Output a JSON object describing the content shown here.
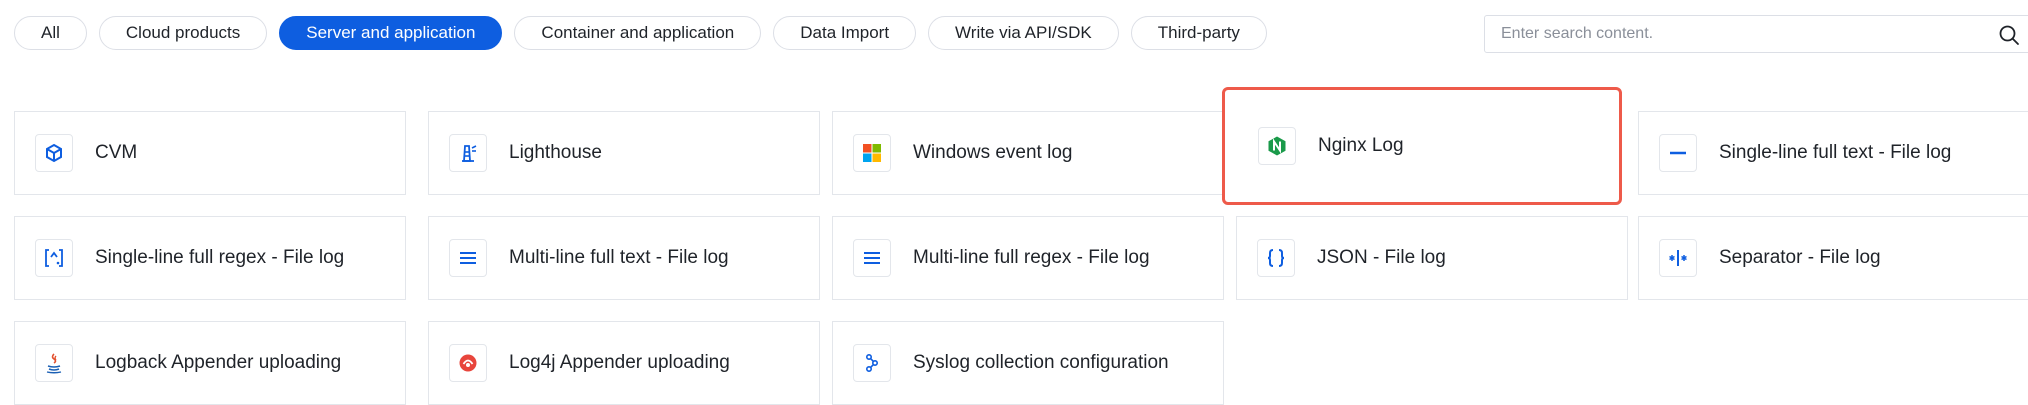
{
  "filters": [
    {
      "label": "All",
      "active": false
    },
    {
      "label": "Cloud products",
      "active": false
    },
    {
      "label": "Server and application",
      "active": true
    },
    {
      "label": "Container and application",
      "active": false
    },
    {
      "label": "Data Import",
      "active": false
    },
    {
      "label": "Write via API/SDK",
      "active": false
    },
    {
      "label": "Third-party",
      "active": false
    }
  ],
  "search": {
    "placeholder": "Enter search content.",
    "icon": "search-icon"
  },
  "colors": {
    "accent": "#0e5ee0",
    "highlight": "#ee5a4a",
    "nginx": "#1a9a4a"
  },
  "cards": [
    {
      "label": "CVM",
      "icon": "cvm-icon"
    },
    {
      "label": "Lighthouse",
      "icon": "lighthouse-icon"
    },
    {
      "label": "Windows event log",
      "icon": "windows-icon"
    },
    {
      "label": "Nginx Log",
      "icon": "nginx-icon",
      "highlighted": true
    },
    {
      "label": "Single-line full text - File log",
      "icon": "single-line-icon"
    },
    {
      "label": "Single-line full regex - File log",
      "icon": "regex-icon"
    },
    {
      "label": "Multi-line full text - File log",
      "icon": "multi-line-icon"
    },
    {
      "label": "Multi-line full regex - File log",
      "icon": "multi-line-regex-icon"
    },
    {
      "label": "JSON - File log",
      "icon": "json-icon"
    },
    {
      "label": "Separator - File log",
      "icon": "separator-icon"
    },
    {
      "label": "Logback Appender uploading",
      "icon": "java-icon"
    },
    {
      "label": "Log4j Appender uploading",
      "icon": "log4j-icon"
    },
    {
      "label": "Syslog collection configuration",
      "icon": "syslog-icon"
    }
  ]
}
